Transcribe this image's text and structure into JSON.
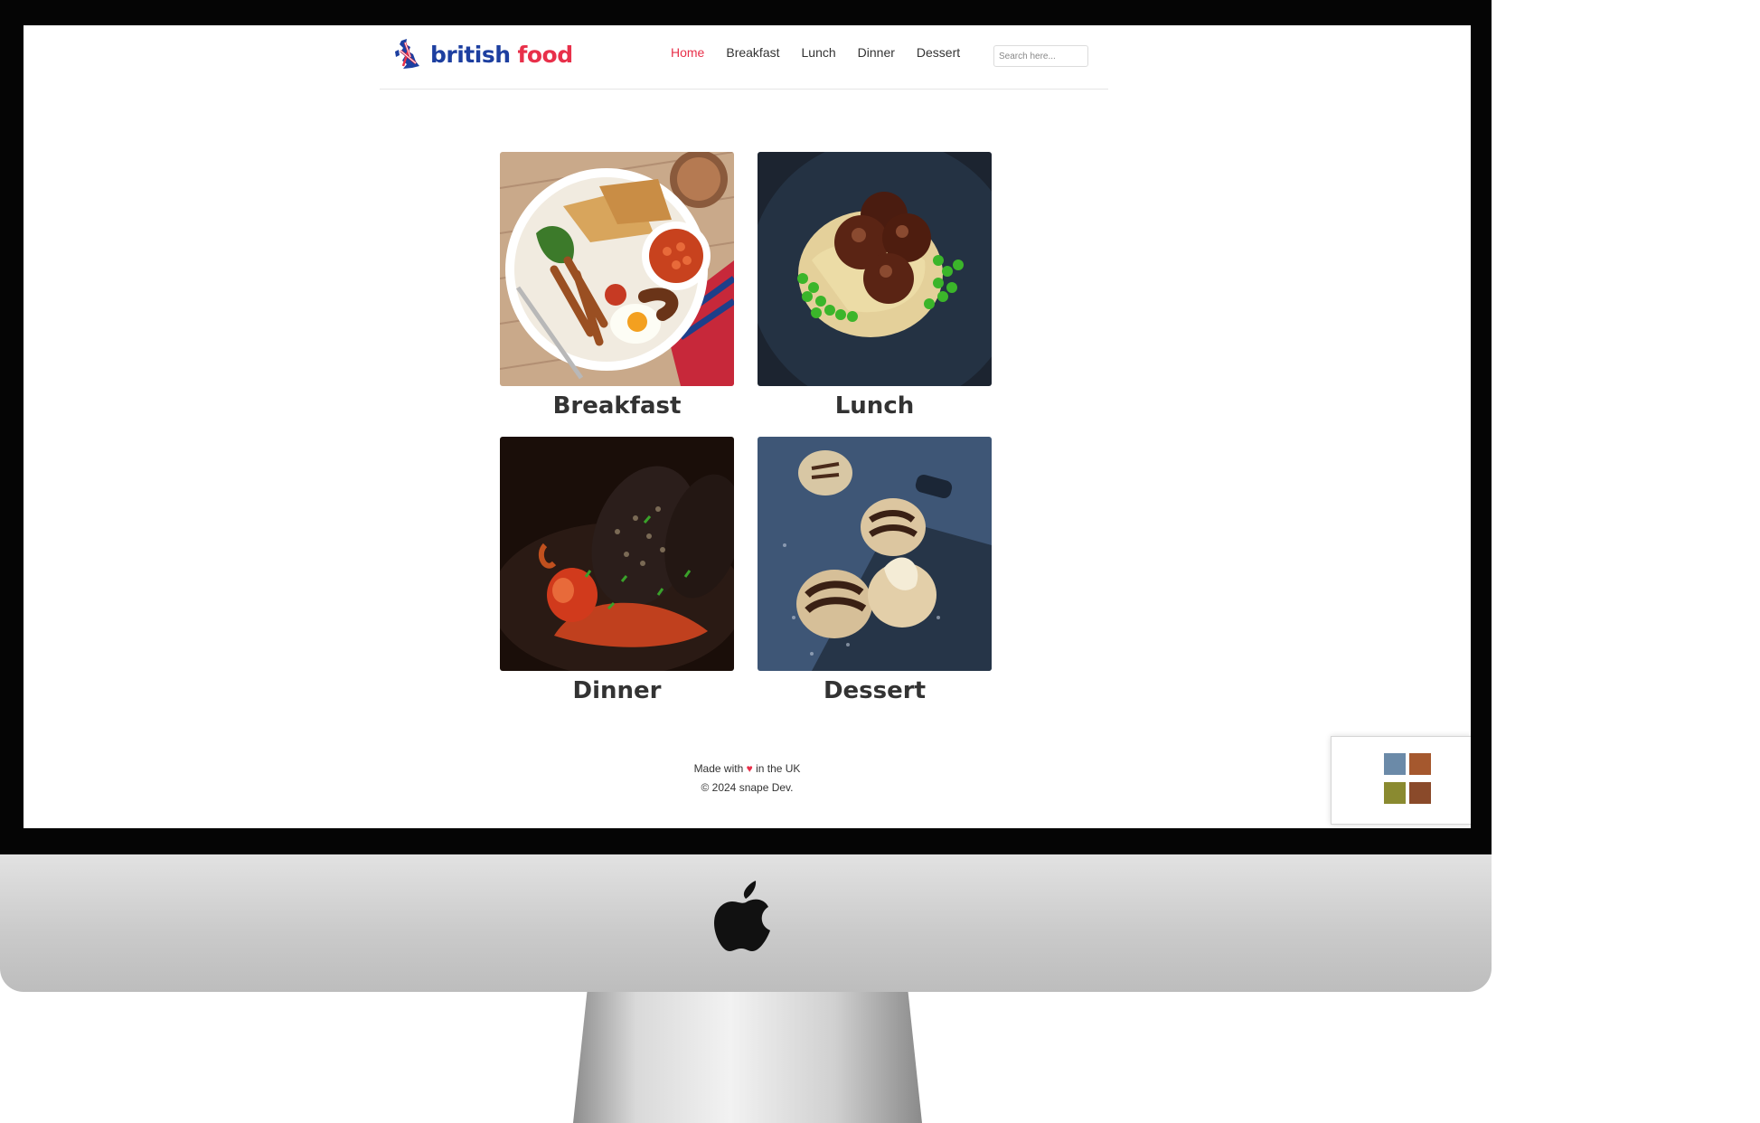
{
  "site": {
    "brand_part1": "british",
    "brand_part2": "food",
    "nav": [
      {
        "label": "Home",
        "active": true
      },
      {
        "label": "Breakfast"
      },
      {
        "label": "Lunch"
      },
      {
        "label": "Dinner"
      },
      {
        "label": "Dessert"
      }
    ],
    "search_placeholder": "Search here..."
  },
  "cards": [
    {
      "title": "Breakfast"
    },
    {
      "title": "Lunch"
    },
    {
      "title": "Dinner"
    },
    {
      "title": "Dessert"
    }
  ],
  "footer": {
    "made_prefix": "Made with",
    "heart": "♥",
    "made_suffix": "in the UK",
    "copyright": "© 2024 snape Dev."
  },
  "colors": {
    "brand_blue": "#1d3fa0",
    "brand_red": "#e8304a"
  }
}
